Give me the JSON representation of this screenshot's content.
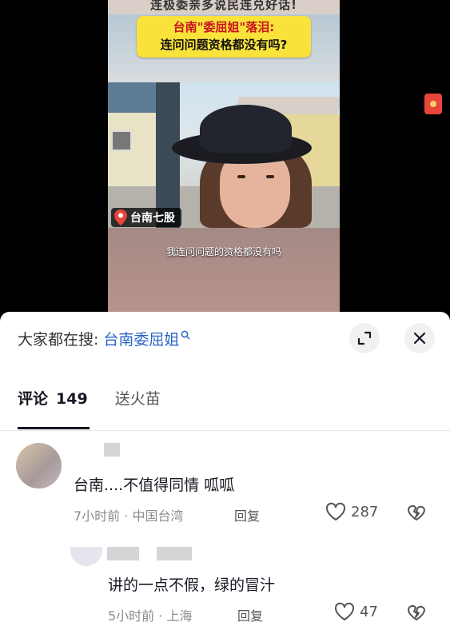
{
  "video": {
    "top_caption": "连极委亲多说民连兑好话!",
    "banner_line1": "台南\"委屈姐\"落泪:",
    "banner_line2": "连问问题资格都没有吗?",
    "location_tag": "台南七股",
    "subtitle": "我连问问题的资格都没有吗"
  },
  "sheet": {
    "search_label": "大家都在搜:",
    "search_term": "台南委屈姐",
    "tabs": [
      {
        "label": "评论",
        "count": "149"
      },
      {
        "label": "送火苗"
      }
    ]
  },
  "comments": [
    {
      "text": "台南....不值得同情 呱呱",
      "time": "7小时前",
      "location": "中国台湾",
      "reply_label": "回复",
      "likes": "287"
    },
    {
      "text": "讲的一点不假，绿的冒汁",
      "time": "5小时前",
      "location": "上海",
      "reply_label": "回复",
      "likes": "47"
    }
  ],
  "colors": {
    "link_blue": "#2b64c8",
    "banner_yellow": "#f9e23a",
    "banner_red": "#c8141e"
  }
}
